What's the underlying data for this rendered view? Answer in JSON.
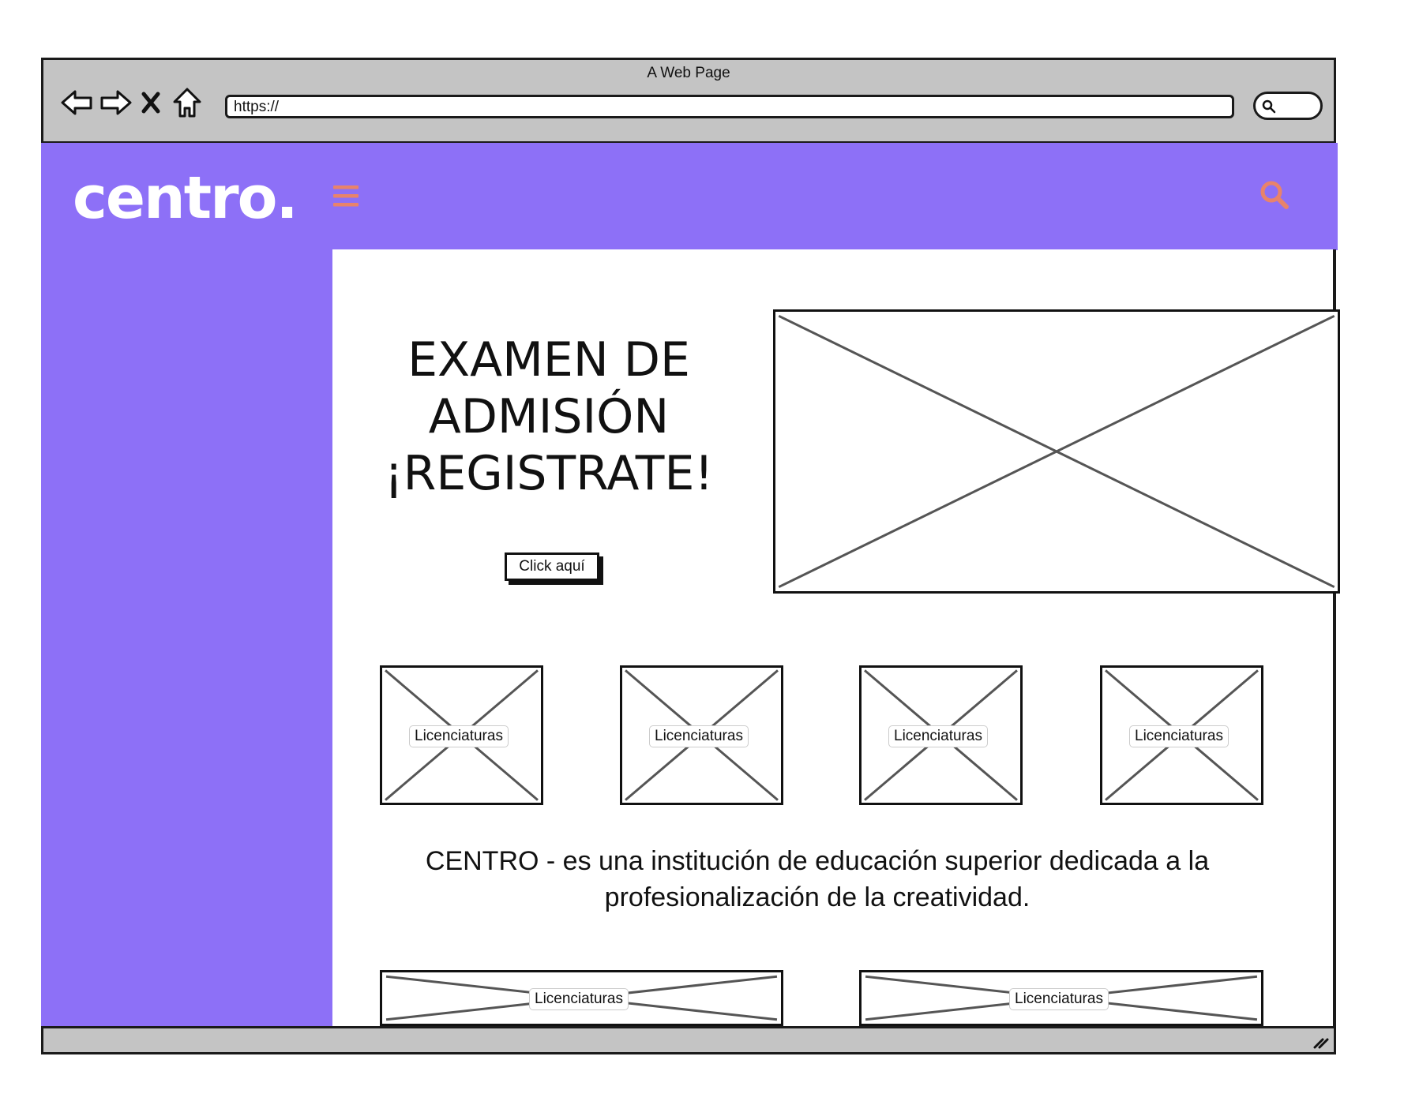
{
  "browser": {
    "window_title": "A Web Page",
    "url": "https://"
  },
  "header": {
    "logo": "centro.",
    "accent_color": "#8d70f7",
    "icon_color": "#e8836b"
  },
  "hero": {
    "heading_line1": "EXAMEN DE",
    "heading_line2": "ADMISIÓN",
    "heading_line3": "¡REGISTRATE!",
    "button_label": "Click aquí"
  },
  "programs": [
    {
      "label": "Licenciaturas"
    },
    {
      "label": "Licenciaturas"
    },
    {
      "label": "Licenciaturas"
    },
    {
      "label": "Licenciaturas"
    }
  ],
  "description": "CENTRO - es una institución de educación superior dedicada a la profesionalización de la creatividad.",
  "banners": [
    {
      "label": "Licenciaturas"
    },
    {
      "label": "Licenciaturas"
    }
  ]
}
